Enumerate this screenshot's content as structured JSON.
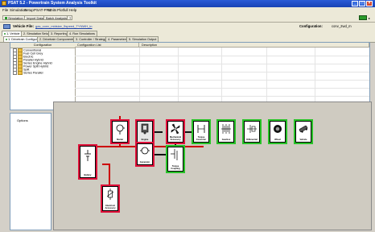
{
  "window": {
    "title": "PSAT 5.2 - Powertrain System Analysis Toolkit"
  },
  "menu": [
    "File",
    "Simulation",
    "Setup",
    "PSAT-PRO",
    "Units",
    "Plotfull",
    "Help"
  ],
  "toolbar": {
    "simulation": "Simulation",
    "import": "Import Data",
    "batch": "Batch Analysis"
  },
  "vehicle": {
    "label": "Vehicle File:",
    "file": "gas_conv_midsize_5speed_TYNWH_in",
    "config_label": "Configuration:",
    "config_value": "conv_2wd_m"
  },
  "main_tabs": [
    "1. Vehicle",
    "2. Simulation Setup",
    "3. Reporting",
    "4. Run Simulations"
  ],
  "sub_tabs": [
    "1. Drivetrain Configuration",
    "2. Drivetrain Components",
    "3. Controller / Strategy",
    "4. Parameters",
    "5. Simulation Output"
  ],
  "config_panel": {
    "header": "Configuration",
    "items": [
      "Conventional",
      "Fuel Cell Grey",
      "Electric",
      "Parallel Hybrid",
      "Series Engine Hybrid",
      "Power Split Hybrid",
      "Split",
      "Series Parallel"
    ],
    "col_list": "Configuration List",
    "col_desc": "Description"
  },
  "options_label": "Options",
  "blocks": [
    {
      "id": "starter",
      "label": "Starter",
      "outline": "red"
    },
    {
      "id": "engine",
      "label": "Engine",
      "outline": "red"
    },
    {
      "id": "mech-acc",
      "label": "Mechanical Accessory",
      "outline": "red"
    },
    {
      "id": "torque-converter",
      "label": "Torque Converter",
      "outline": "green"
    },
    {
      "id": "gearbox",
      "label": "Gearbox",
      "outline": "green"
    },
    {
      "id": "differential",
      "label": "Differential",
      "outline": "green"
    },
    {
      "id": "wheel",
      "label": "Wheel",
      "outline": "green"
    },
    {
      "id": "vehicle",
      "label": "Vehicle",
      "outline": "green"
    },
    {
      "id": "battery",
      "label": "Battery",
      "outline": "red"
    },
    {
      "id": "generator",
      "label": "Generator",
      "outline": "red"
    },
    {
      "id": "torque-coupling",
      "label": "Torque Coupling",
      "outline": "green"
    },
    {
      "id": "elec-acc",
      "label": "Electrical Accessory",
      "outline": "red"
    }
  ],
  "colors": {
    "title_bar": "#1842b4",
    "power_link": "#e0103a",
    "mech_link": "#27c227"
  }
}
